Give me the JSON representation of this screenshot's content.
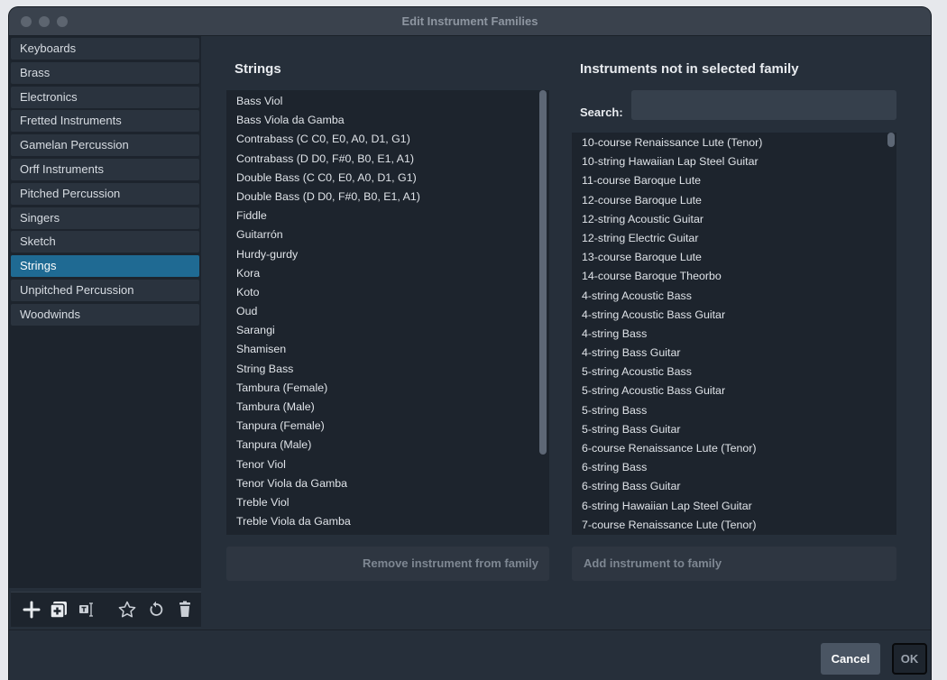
{
  "window": {
    "title": "Edit Instrument Families"
  },
  "families": {
    "items": [
      "Keyboards",
      "Brass",
      "Electronics",
      "Fretted Instruments",
      "Gamelan Percussion",
      "Orff Instruments",
      "Pitched Percussion",
      "Singers",
      "Sketch",
      "Strings",
      "Unpitched Percussion",
      "Woodwinds"
    ],
    "selected": "Strings"
  },
  "toolbar": {
    "icons": [
      "plus-icon",
      "duplicate-icon",
      "rename-icon",
      "star-icon",
      "reset-icon",
      "trash-icon"
    ]
  },
  "family_members": {
    "heading": "Strings",
    "items": [
      "Bass Viol",
      "Bass Viola da Gamba",
      "Contrabass (C C0, E0, A0, D1, G1)",
      "Contrabass (D D0, F#0, B0, E1, A1)",
      "Double Bass (C C0, E0, A0, D1, G1)",
      "Double Bass (D D0, F#0, B0, E1, A1)",
      "Fiddle",
      "Guitarrón",
      "Hurdy-gurdy",
      "Kora",
      "Koto",
      "Oud",
      "Sarangi",
      "Shamisen",
      "String Bass",
      "Tambura (Female)",
      "Tambura (Male)",
      "Tanpura (Female)",
      "Tanpura (Male)",
      "Tenor Viol",
      "Tenor Viola da Gamba",
      "Treble Viol",
      "Treble Viola da Gamba"
    ],
    "remove_label": "Remove instrument from family"
  },
  "not_in_family": {
    "heading": "Instruments not in selected family",
    "search_label": "Search:",
    "search_value": "",
    "items": [
      "10-course Renaissance Lute (Tenor)",
      "10-string Hawaiian Lap Steel Guitar",
      "11-course Baroque Lute",
      "12-course Baroque Lute",
      "12-string Acoustic Guitar",
      "12-string Electric Guitar",
      "13-course Baroque Lute",
      "14-course Baroque Theorbo",
      "4-string Acoustic Bass",
      "4-string Acoustic Bass Guitar",
      "4-string Bass",
      "4-string Bass Guitar",
      "5-string Acoustic Bass",
      "5-string Acoustic Bass Guitar",
      "5-string Bass",
      "5-string Bass Guitar",
      "6-course Renaissance Lute (Tenor)",
      "6-string Bass",
      "6-string Bass Guitar",
      "6-string Hawaiian Lap Steel Guitar",
      "7-course Renaissance Lute (Tenor)"
    ],
    "add_label": "Add instrument to family"
  },
  "footer": {
    "cancel_label": "Cancel",
    "ok_label": "OK"
  },
  "colors": {
    "accent": "#1f6a93",
    "window_bg": "#262f3a",
    "list_bg": "#1d242d"
  }
}
